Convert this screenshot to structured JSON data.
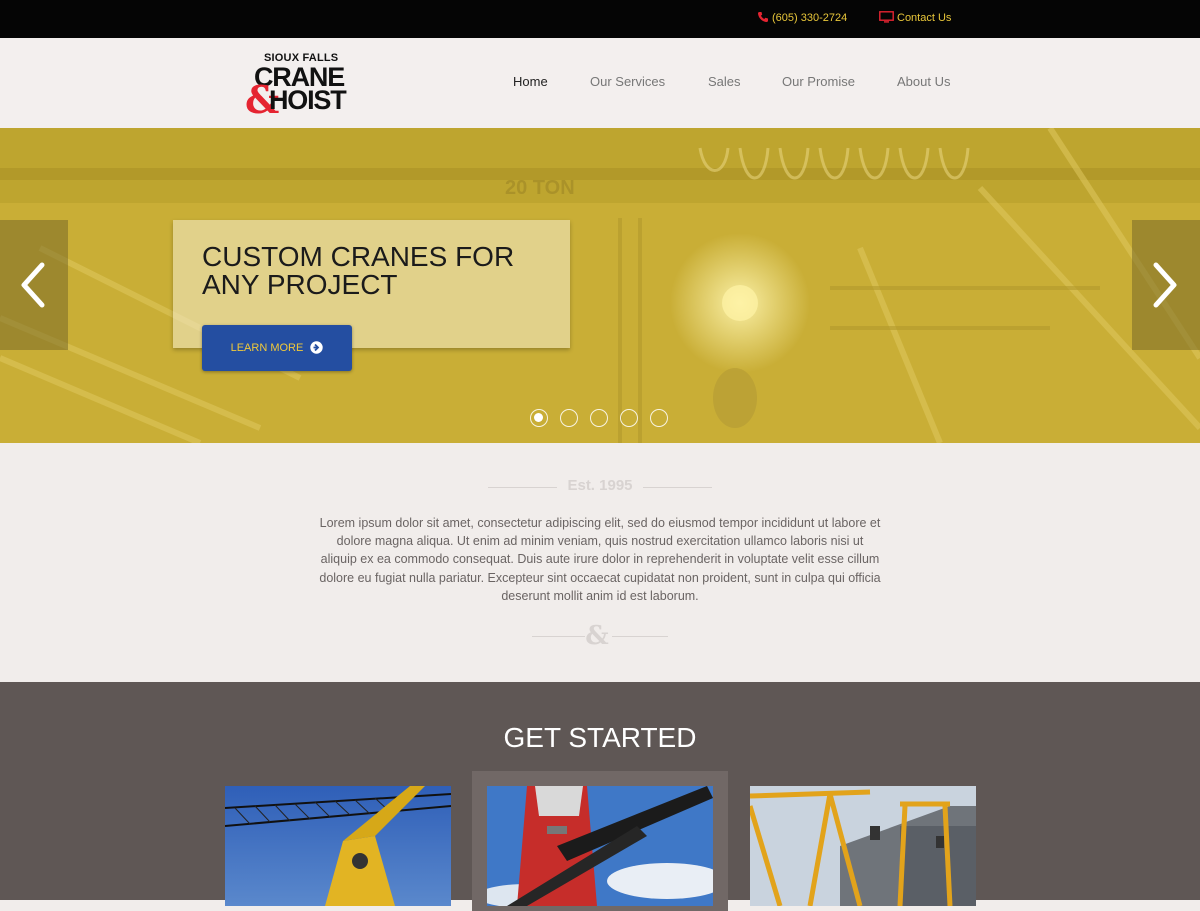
{
  "topbar": {
    "phone": "(605) 330-2724",
    "contact": "Contact Us",
    "accent": "#e9c73a",
    "icon_color": "#e52431",
    "phone_icon": "phone-icon",
    "contact_icon": "monitor-icon"
  },
  "logo": {
    "line1": "SIOUX FALLS",
    "line2": "CRANE",
    "amp": "&",
    "line3": "HOIST"
  },
  "nav": {
    "items": [
      {
        "label": "Home",
        "active": true
      },
      {
        "label": "Our Services",
        "active": false
      },
      {
        "label": "Sales",
        "active": false
      },
      {
        "label": "Our Promise",
        "active": false
      },
      {
        "label": "About Us",
        "active": false
      }
    ]
  },
  "hero": {
    "title": "CUSTOM CRANES FOR ANY PROJECT",
    "button": "LEARN MORE",
    "overlay_color": "#c8ae35",
    "slide_count": 5,
    "active_slide": 1,
    "photo_text": "20 TON",
    "prev_icon": "chevron-left-icon",
    "next_icon": "chevron-right-icon"
  },
  "intro": {
    "est": "Est. 1995",
    "body": "Lorem ipsum dolor sit amet, consectetur adipiscing elit, sed do eiusmod tempor incididunt ut labore et dolore magna aliqua. Ut enim ad minim veniam, quis nostrud exercitation ullamco laboris nisi ut aliquip ex ea commodo consequat. Duis aute irure dolor in reprehenderit in voluptate velit esse cillum dolore eu fugiat nulla pariatur. Excepteur sint occaecat cupidatat non proident, sunt in culpa qui officia deserunt mollit anim id est laborum.",
    "divider": "&"
  },
  "get_started": {
    "title": "GET STARTED",
    "cards": [
      "tower-crane-photo",
      "mobile-crane-photo",
      "gantry-crane-photo"
    ]
  }
}
